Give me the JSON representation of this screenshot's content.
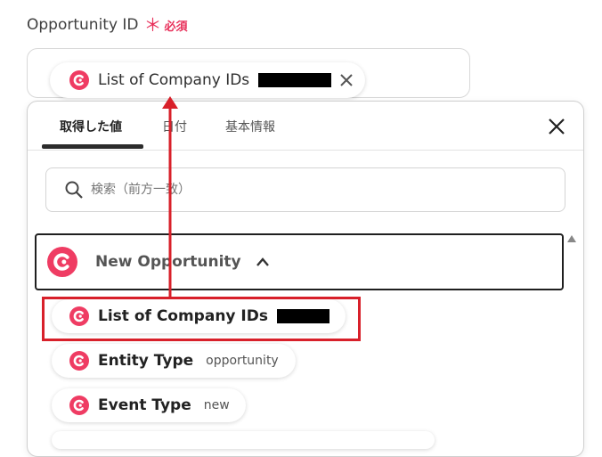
{
  "field": {
    "label": "Opportunity ID",
    "required_star": "＊",
    "required_text": "必須",
    "selected_chip": {
      "label": "List of Company IDs"
    }
  },
  "panel": {
    "tabs": [
      {
        "label": "取得した値",
        "active": true
      },
      {
        "label": "日付",
        "active": false
      },
      {
        "label": "基本情報",
        "active": false
      }
    ],
    "search": {
      "placeholder": "検索（前方一致）"
    },
    "group": {
      "title": "New Opportunity",
      "expanded": true
    },
    "items": [
      {
        "label": "List of Company IDs",
        "value": ""
      },
      {
        "label": "Entity Type",
        "value": "opportunity"
      },
      {
        "label": "Event Type",
        "value": "new"
      }
    ]
  },
  "colors": {
    "brand": "#ef3c63",
    "highlight": "#d8202a",
    "required": "#e8315b"
  },
  "icons": [
    "app-logo-icon",
    "close-icon",
    "search-icon",
    "chevron-up-icon",
    "scroll-up-icon"
  ]
}
